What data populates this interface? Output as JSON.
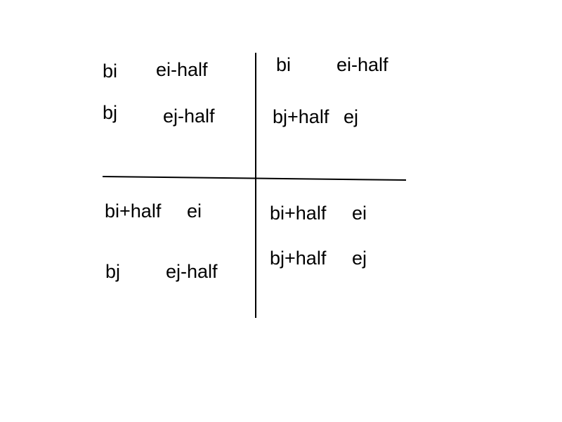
{
  "quadrants": {
    "top_left": {
      "row1": {
        "begin": "bi",
        "end": "ei-half"
      },
      "row2": {
        "begin": "bj",
        "end": "ej-half"
      }
    },
    "top_right": {
      "row1": {
        "begin": "bi",
        "end": "ei-half"
      },
      "row2": {
        "begin": "bj+half",
        "end": "ej"
      }
    },
    "bottom_left": {
      "row1": {
        "begin": "bi+half",
        "end": "ei"
      },
      "row2": {
        "begin": "bj",
        "end": "ej-half"
      }
    },
    "bottom_right": {
      "row1": {
        "begin": "bi+half",
        "end": "ei"
      },
      "row2": {
        "begin": "bj+half",
        "end": "ej"
      }
    }
  },
  "colors": {
    "ink": "#000000",
    "background": "#ffffff"
  }
}
